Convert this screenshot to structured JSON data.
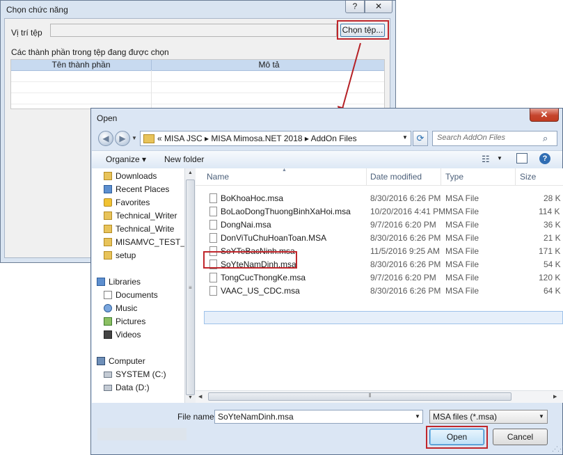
{
  "back_dialog": {
    "title": "Chọn chức năng",
    "help_label": "?",
    "close_label": "✕",
    "location_label": "Vị trí tệp",
    "file_path_value": "",
    "choose_file_button": "Chọn tệp...",
    "components_label": "Các thành phần trong tệp đang được chọn",
    "columns": [
      "Tên thành phần",
      "Mô tả"
    ]
  },
  "open_dialog": {
    "title": "Open",
    "close_label": "✕",
    "nav_back": "◀",
    "nav_forward": "▶",
    "address_breadcrumb": "«  MISA JSC  ▸  MISA Mimosa.NET 2018  ▸  AddOn Files",
    "refresh": "⟳",
    "search_placeholder": "Search AddOn Files",
    "search_icon": "⌕",
    "toolbar": {
      "organize": "Organize ▾",
      "new_folder": "New folder",
      "view": "☷",
      "help": "?"
    },
    "navigation": [
      {
        "label": "Downloads",
        "icon": "folder-download-icon"
      },
      {
        "label": "Recent Places",
        "icon": "recent-places-icon"
      },
      {
        "label": "Favorites",
        "icon": "favorites-star-icon"
      },
      {
        "label": "Technical_Writer",
        "icon": "folder-icon"
      },
      {
        "label": "Technical_Write",
        "icon": "folder-icon"
      },
      {
        "label": "MISAMVC_TEST_",
        "icon": "folder-icon"
      },
      {
        "label": "setup",
        "icon": "folder-icon"
      },
      {
        "label": "Libraries",
        "icon": "libraries-icon"
      },
      {
        "label": "Documents",
        "icon": "documents-icon"
      },
      {
        "label": "Music",
        "icon": "music-icon"
      },
      {
        "label": "Pictures",
        "icon": "pictures-icon"
      },
      {
        "label": "Videos",
        "icon": "videos-icon"
      },
      {
        "label": "Computer",
        "icon": "computer-icon"
      },
      {
        "label": "SYSTEM (C:)",
        "icon": "drive-icon"
      },
      {
        "label": "Data (D:)",
        "icon": "drive-icon"
      }
    ],
    "columns": {
      "name": "Name",
      "date": "Date modified",
      "type": "Type",
      "size": "Size"
    },
    "files": [
      {
        "name": "BoKhoaHoc.msa",
        "date": "8/30/2016 6:26 PM",
        "type": "MSA File",
        "size": "28 K"
      },
      {
        "name": "BoLaoDongThuongBinhXaHoi.msa",
        "date": "10/20/2016 4:41 PM",
        "type": "MSA File",
        "size": "114 K"
      },
      {
        "name": "DongNai.msa",
        "date": "9/7/2016 6:20 PM",
        "type": "MSA File",
        "size": "36 K"
      },
      {
        "name": "DonViTuChuHoanToan.MSA",
        "date": "8/30/2016 6:26 PM",
        "type": "MSA File",
        "size": "21 K"
      },
      {
        "name": "SoYTeBacNinh.msa",
        "date": "11/5/2016 9:25 AM",
        "type": "MSA File",
        "size": "171 K"
      },
      {
        "name": "SoYteNamDinh.msa",
        "date": "8/30/2016 6:26 PM",
        "type": "MSA File",
        "size": "54 K",
        "selected": true
      },
      {
        "name": "TongCucThongKe.msa",
        "date": "9/7/2016 6:20 PM",
        "type": "MSA File",
        "size": "120 K"
      },
      {
        "name": "VAAC_US_CDC.msa",
        "date": "8/30/2016 6:26 PM",
        "type": "MSA File",
        "size": "64 K"
      }
    ],
    "file_name_label": "File name:",
    "file_name_value": "SoYteNamDinh.msa",
    "file_type_value": "MSA files (*.msa)",
    "open_button": "Open",
    "cancel_button": "Cancel"
  },
  "colors": {
    "highlight_red": "#c0262b",
    "selection_blue": "#e6effa"
  }
}
